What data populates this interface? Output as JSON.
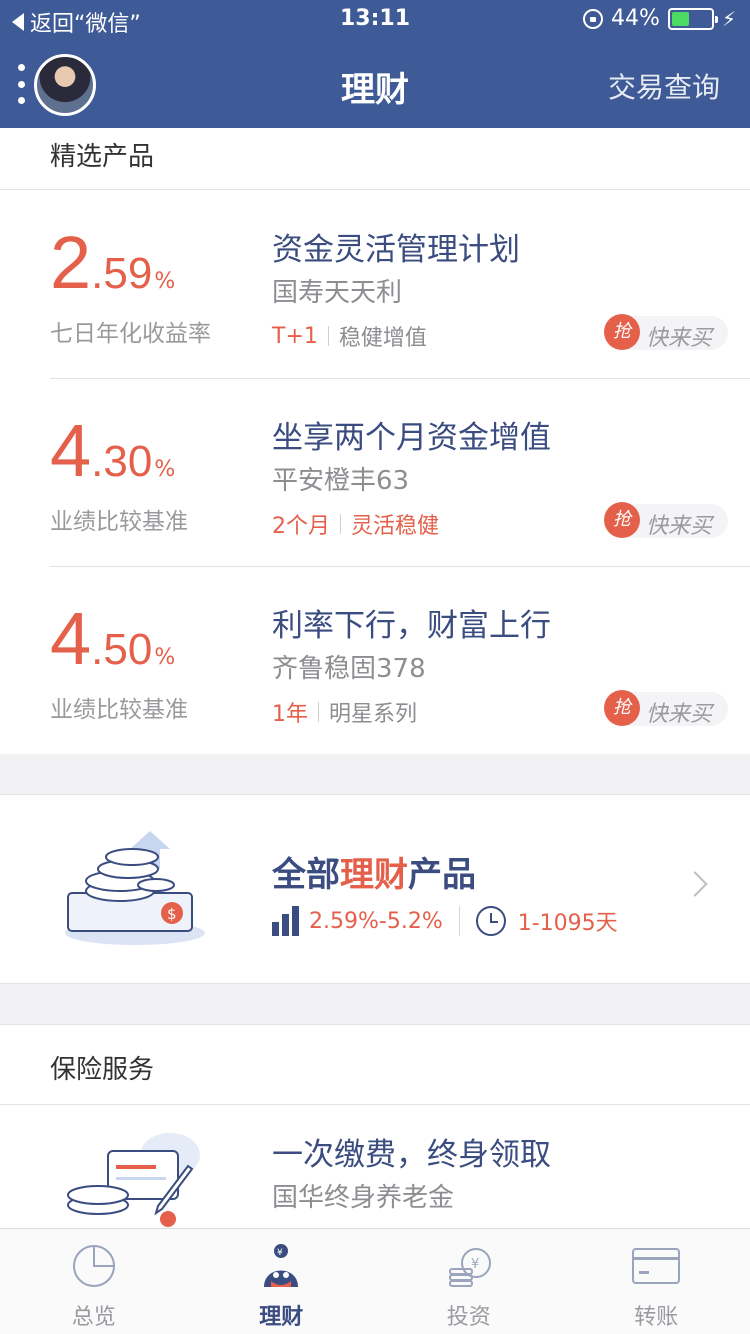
{
  "status_bar": {
    "back_label": "返回“微信”",
    "time": "13:11",
    "battery": "44%",
    "battery_level": 0.44
  },
  "nav": {
    "title": "理财",
    "right_action": "交易查询"
  },
  "featured": {
    "heading": "精选产品",
    "buy_badge": "抢",
    "buy_label": "快来买",
    "products": [
      {
        "rate_int": "2",
        "rate_dec": ".59",
        "rate_unit": "%",
        "rate_label": "七日年化收益率",
        "name": "资金灵活管理计划",
        "sub": "国寿天天利",
        "tag1": "T+1",
        "tag2": "稳健增值"
      },
      {
        "rate_int": "4",
        "rate_dec": ".30",
        "rate_unit": "%",
        "rate_label": "业绩比较基准",
        "name": "坐享两个月资金增值",
        "sub": "平安橙丰63",
        "tag1": "2个月",
        "tag2": "灵活稳健"
      },
      {
        "rate_int": "4",
        "rate_dec": ".50",
        "rate_unit": "%",
        "rate_label": "业绩比较基准",
        "name": "利率下行，财富上行",
        "sub": "齐鲁稳固378",
        "tag1": "1年",
        "tag2": "明星系列"
      }
    ]
  },
  "all_products": {
    "title_prefix": "全部",
    "title_highlight": "理财",
    "title_suffix": "产品",
    "rate_range": "2.59%-5.2%",
    "term_range": "1-1095天"
  },
  "insurance": {
    "heading": "保险服务",
    "name": "一次缴费，终身领取",
    "sub": "国华终身养老金"
  },
  "tabs": [
    {
      "label": "总览",
      "icon": "pie-chart-icon"
    },
    {
      "label": "理财",
      "icon": "penguin-coin-icon"
    },
    {
      "label": "投资",
      "icon": "coin-stack-icon"
    },
    {
      "label": "转账",
      "icon": "card-icon"
    }
  ],
  "colors": {
    "nav_bg": "#3f5b97",
    "accent": "#e4604a",
    "primary_text": "#3b4d80",
    "battery_fill": "#4cd964"
  }
}
